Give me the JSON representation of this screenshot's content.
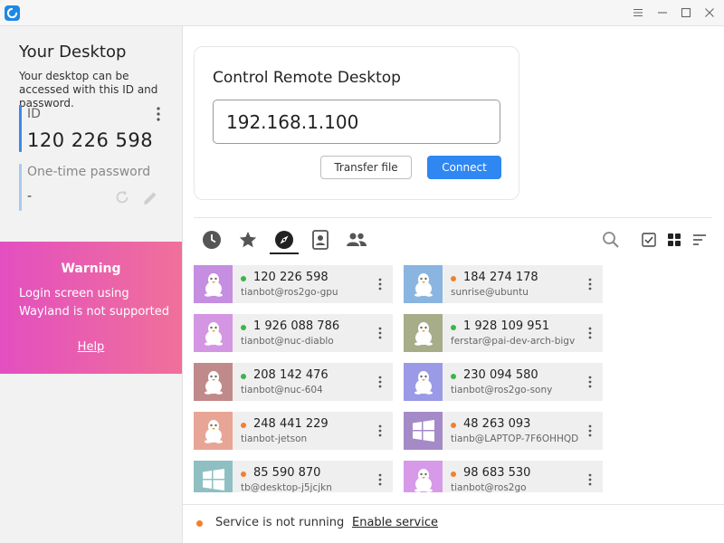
{
  "colors": {
    "accent": "#2f87f2",
    "online": "#3cb44b",
    "offline": "#f08030",
    "warning_start": "#e34fc0",
    "warning_end": "#f0709a"
  },
  "window": {
    "logo_icon": "rustdesk-logo-icon",
    "controls": [
      "menu-icon",
      "minimize-icon",
      "maximize-icon",
      "close-icon"
    ]
  },
  "sidebar": {
    "title": "Your Desktop",
    "description": "Your desktop can be accessed with this ID and password.",
    "id_label": "ID",
    "id_value": "120 226 598",
    "password_label": "One-time password",
    "password_value": "-"
  },
  "warning": {
    "title": "Warning",
    "text": "Login screen using Wayland is not supported",
    "help_link": "Help"
  },
  "control": {
    "title": "Control Remote Desktop",
    "address_value": "192.168.1.100",
    "transfer_label": "Transfer file",
    "connect_label": "Connect"
  },
  "tabs": [
    "recent-sessions-icon",
    "favorites-icon",
    "discovered-icon",
    "address-book-icon",
    "group-icon"
  ],
  "active_tab": 2,
  "peers": [
    {
      "id": "120 226 598",
      "user": "tianbot@ros2go-gpu",
      "status": "online",
      "os": "linux",
      "color": "#c58ee0"
    },
    {
      "id": "184 274 178",
      "user": "sunrise@ubuntu",
      "status": "offline",
      "os": "linux",
      "color": "#8ab5e0"
    },
    {
      "id": "1 926 088 786",
      "user": "tianbot@nuc-diablo",
      "status": "online",
      "os": "linux",
      "color": "#d496e2"
    },
    {
      "id": "1 928 109 951",
      "user": "ferstar@pai-dev-arch-bigv",
      "status": "online",
      "os": "linux",
      "color": "#a6ad88"
    },
    {
      "id": "208 142 476",
      "user": "tianbot@nuc-604",
      "status": "online",
      "os": "linux",
      "color": "#c08a8a"
    },
    {
      "id": "230 094 580",
      "user": "tianbot@ros2go-sony",
      "status": "online",
      "os": "linux",
      "color": "#9a9ae6"
    },
    {
      "id": "248 441 229",
      "user": "tianbot-jetson",
      "status": "offline",
      "os": "linux",
      "color": "#e8a595"
    },
    {
      "id": "48 263 093",
      "user": "tianb@LAPTOP-7F6OHHQD",
      "status": "offline",
      "os": "windows",
      "color": "#a58ac8"
    },
    {
      "id": "85 590 870",
      "user": "tb@desktop-j5jcjkn",
      "status": "offline",
      "os": "windows",
      "color": "#8fbfc2"
    },
    {
      "id": "98 683 530",
      "user": "tianbot@ros2go",
      "status": "offline",
      "os": "linux",
      "color": "#d69ae8"
    }
  ],
  "footer": {
    "status_text": "Service is not running",
    "enable_link": "Enable service"
  }
}
